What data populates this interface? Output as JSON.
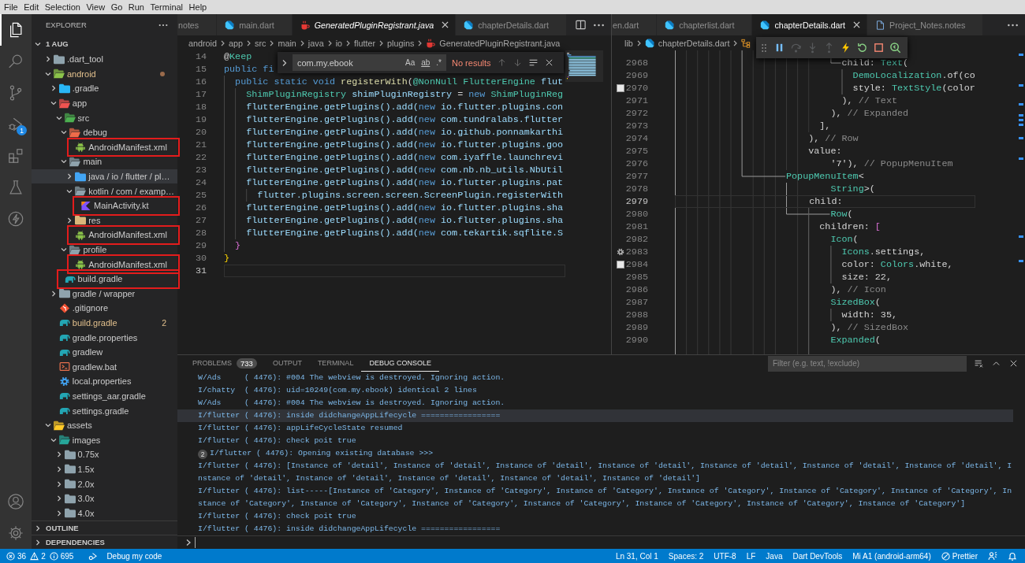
{
  "menu_bar": [
    "File",
    "Edit",
    "Selection",
    "View",
    "Go",
    "Run",
    "Terminal",
    "Help"
  ],
  "activity_bar": {
    "items": [
      {
        "kind": "files",
        "selected": true
      },
      {
        "kind": "search",
        "selected": false
      },
      {
        "kind": "source-control",
        "selected": false
      },
      {
        "kind": "run-debug",
        "selected": false,
        "badge": "1"
      },
      {
        "kind": "extensions",
        "selected": false
      },
      {
        "kind": "testing",
        "selected": false
      },
      {
        "kind": "lightning",
        "selected": false
      }
    ],
    "bottom": [
      {
        "kind": "account"
      },
      {
        "kind": "manage"
      }
    ]
  },
  "explorer": {
    "title": "EXPLORER",
    "root": {
      "label": "1 AUG",
      "expanded": true
    },
    "tree": [
      {
        "label": ".dart_tool",
        "kind": "folder",
        "expanded": false,
        "modified": false,
        "hovered": false,
        "annotated": false
      },
      {
        "label": "android",
        "kind": "android-folder",
        "expanded": true,
        "modified": true,
        "hovered": false,
        "annotated": false,
        "children": [
          {
            "label": ".gradle",
            "kind": "gradle-folder",
            "expanded": false,
            "modified": false,
            "hovered": false,
            "annotated": false
          },
          {
            "label": "app",
            "kind": "app-folder",
            "expanded": true,
            "modified": false,
            "hovered": false,
            "annotated": false,
            "children": [
              {
                "label": "src",
                "kind": "src-folder",
                "expanded": true,
                "modified": false,
                "hovered": false,
                "annotated": false,
                "children": [
                  {
                    "label": "debug",
                    "kind": "debug-folder",
                    "expanded": true,
                    "modified": false,
                    "hovered": false,
                    "annotated": false,
                    "children": [
                      {
                        "label": "AndroidManifest.xml",
                        "kind": "android-file",
                        "modified": false,
                        "hovered": false,
                        "annotated": true
                      }
                    ]
                  },
                  {
                    "label": "main",
                    "kind": "folder",
                    "expanded": true,
                    "modified": false,
                    "hovered": false,
                    "annotated": false,
                    "children": [
                      {
                        "label": "java / io / flutter / pl…",
                        "kind": "java-folder",
                        "expanded": false,
                        "modified": false,
                        "hovered": true,
                        "annotated": false
                      },
                      {
                        "label": "kotlin / com / examp…",
                        "kind": "folder",
                        "expanded": true,
                        "modified": false,
                        "hovered": false,
                        "annotated": false,
                        "children": [
                          {
                            "label": "MainActivity.kt",
                            "kind": "kotlin-file",
                            "modified": false,
                            "hovered": false,
                            "annotated": true
                          }
                        ]
                      },
                      {
                        "label": "res",
                        "kind": "res-folder",
                        "expanded": false,
                        "modified": false,
                        "hovered": false,
                        "annotated": false
                      },
                      {
                        "label": "AndroidManifest.xml",
                        "kind": "android-file",
                        "modified": false,
                        "hovered": false,
                        "annotated": true
                      }
                    ]
                  },
                  {
                    "label": "profile",
                    "kind": "folder",
                    "expanded": true,
                    "modified": false,
                    "hovered": false,
                    "annotated": false,
                    "children": [
                      {
                        "label": "AndroidManifest.xml",
                        "kind": "android-file",
                        "modified": false,
                        "hovered": false,
                        "annotated": true
                      }
                    ]
                  }
                ]
              },
              {
                "label": "build.gradle",
                "kind": "gradle-file",
                "modified": false,
                "hovered": false,
                "annotated": true
              }
            ]
          },
          {
            "label": "gradle / wrapper",
            "kind": "folder",
            "expanded": false,
            "modified": false,
            "hovered": false,
            "annotated": false
          },
          {
            "label": ".gitignore",
            "kind": "git-file",
            "modified": false,
            "hovered": false,
            "annotated": false
          },
          {
            "label": "build.gradle",
            "kind": "gradle-file",
            "modified": true,
            "badge": "2",
            "hovered": false,
            "annotated": false
          },
          {
            "label": "gradle.properties",
            "kind": "gradle-file",
            "modified": false,
            "hovered": false,
            "annotated": false
          },
          {
            "label": "gradlew",
            "kind": "gradle-file",
            "modified": false,
            "hovered": false,
            "annotated": false
          },
          {
            "label": "gradlew.bat",
            "kind": "script-file",
            "modified": false,
            "hovered": false,
            "annotated": false
          },
          {
            "label": "local.properties",
            "kind": "settings-file",
            "modified": false,
            "hovered": false,
            "annotated": false
          },
          {
            "label": "settings_aar.gradle",
            "kind": "gradle-file",
            "modified": false,
            "hovered": false,
            "annotated": false
          },
          {
            "label": "settings.gradle",
            "kind": "gradle-file",
            "modified": false,
            "hovered": false,
            "annotated": false
          }
        ]
      },
      {
        "label": "assets",
        "kind": "assets-folder",
        "expanded": true,
        "modified": false,
        "hovered": false,
        "annotated": false,
        "children": [
          {
            "label": "images",
            "kind": "images-folder",
            "expanded": true,
            "modified": false,
            "hovered": false,
            "annotated": false,
            "children": [
              {
                "label": "0.75x",
                "kind": "folder",
                "expanded": false,
                "modified": false,
                "hovered": false,
                "annotated": false
              },
              {
                "label": "1.5x",
                "kind": "folder",
                "expanded": false,
                "modified": false,
                "hovered": false,
                "annotated": false
              },
              {
                "label": "2.0x",
                "kind": "folder",
                "expanded": false,
                "modified": false,
                "hovered": false,
                "annotated": false
              },
              {
                "label": "3.0x",
                "kind": "folder",
                "expanded": false,
                "modified": false,
                "hovered": false,
                "annotated": false
              },
              {
                "label": "4.0x",
                "kind": "folder",
                "expanded": false,
                "modified": false,
                "hovered": false,
                "annotated": false
              }
            ]
          }
        ]
      }
    ],
    "sections": [
      {
        "label": "OUTLINE",
        "expanded": false
      },
      {
        "label": "DEPENDENCIES",
        "expanded": false
      }
    ]
  },
  "editor_groups": [
    {
      "tabs": [
        {
          "label": "notes",
          "kind": "partial",
          "selected": false,
          "preview": false
        },
        {
          "label": "main.dart",
          "kind": "dart",
          "selected": false,
          "preview": false
        },
        {
          "label": "GeneratedPluginRegistrant.java",
          "kind": "java",
          "selected": true,
          "preview": true
        },
        {
          "label": "chapterDetails.dart",
          "kind": "dart",
          "selected": false,
          "preview": false
        }
      ],
      "actions": [
        {
          "kind": "split"
        },
        {
          "kind": "more"
        }
      ],
      "breadcrumbs": [
        {
          "label": "android",
          "kind": "folder"
        },
        {
          "label": "app",
          "kind": "folder"
        },
        {
          "label": "src",
          "kind": "folder"
        },
        {
          "label": "main",
          "kind": "folder"
        },
        {
          "label": "java",
          "kind": "folder"
        },
        {
          "label": "io",
          "kind": "folder"
        },
        {
          "label": "flutter",
          "kind": "folder"
        },
        {
          "label": "plugins",
          "kind": "folder"
        },
        {
          "label": "GeneratedPluginRegistrant.java",
          "kind": "java"
        }
      ],
      "find_widget": {
        "expanded": false,
        "value": "com.my.ebook",
        "options": [
          {
            "label": "Aa",
            "on": false
          },
          {
            "label": "ab",
            "on": false
          },
          {
            "label": ".*",
            "on": false
          }
        ],
        "result": "No results",
        "buttons": [
          {
            "kind": "previous",
            "disabled": true
          },
          {
            "kind": "next",
            "disabled": true
          },
          {
            "kind": "in-selection",
            "disabled": false
          },
          {
            "kind": "close",
            "disabled": false
          }
        ]
      },
      "lines": [
        {
          "number": "14",
          "current": false,
          "tokens": [
            {
              "text": "@",
              "kind": "plain"
            },
            {
              "text": "Keep",
              "kind": "type"
            }
          ]
        },
        {
          "number": "15",
          "current": false,
          "tokens": [
            {
              "text": "public fi",
              "kind": "keyword"
            }
          ]
        },
        {
          "number": "16",
          "current": false,
          "tokens": [
            {
              "text": "  public static void ",
              "kind": "keyword"
            },
            {
              "text": "registerWith",
              "kind": "function"
            },
            {
              "text": "(",
              "kind": "plain"
            },
            {
              "text": "@NonNull FlutterEngine ",
              "kind": "type"
            },
            {
              "text": "flut",
              "kind": "variable"
            }
          ]
        },
        {
          "number": "17",
          "current": false,
          "tokens": [
            {
              "text": "    ShimPluginRegistry ",
              "kind": "type"
            },
            {
              "text": "shimPluginRegistry ",
              "kind": "variable"
            },
            {
              "text": "= ",
              "kind": "plain"
            },
            {
              "text": "new",
              "kind": "keyword"
            },
            {
              "text": " ShimPluginReg",
              "kind": "type"
            }
          ]
        },
        {
          "number": "18",
          "current": false,
          "tokens": [
            {
              "text": "    flutterEngine.getPlugins().add(",
              "kind": "variable"
            },
            {
              "text": "new",
              "kind": "keyword"
            },
            {
              "text": " io.flutter.plugins.con",
              "kind": "variable"
            }
          ]
        },
        {
          "number": "19",
          "current": false,
          "tokens": [
            {
              "text": "    flutterEngine.getPlugins().add(",
              "kind": "variable"
            },
            {
              "text": "new",
              "kind": "keyword"
            },
            {
              "text": " com.tundralabs.flutter",
              "kind": "variable"
            }
          ]
        },
        {
          "number": "20",
          "current": false,
          "tokens": [
            {
              "text": "    flutterEngine.getPlugins().add(",
              "kind": "variable"
            },
            {
              "text": "new",
              "kind": "keyword"
            },
            {
              "text": " io.github.ponnamkarthi",
              "kind": "variable"
            }
          ]
        },
        {
          "number": "21",
          "current": false,
          "tokens": [
            {
              "text": "    flutterEngine.getPlugins().add(",
              "kind": "variable"
            },
            {
              "text": "new",
              "kind": "keyword"
            },
            {
              "text": " io.flutter.plugins.goo",
              "kind": "variable"
            }
          ]
        },
        {
          "number": "22",
          "current": false,
          "tokens": [
            {
              "text": "    flutterEngine.getPlugins().add(",
              "kind": "variable"
            },
            {
              "text": "new",
              "kind": "keyword"
            },
            {
              "text": " com.iyaffle.launchrevi",
              "kind": "variable"
            }
          ]
        },
        {
          "number": "23",
          "current": false,
          "tokens": [
            {
              "text": "    flutterEngine.getPlugins().add(",
              "kind": "variable"
            },
            {
              "text": "new",
              "kind": "keyword"
            },
            {
              "text": " com.nb.nb_utils.NbUtil",
              "kind": "variable"
            }
          ]
        },
        {
          "number": "24",
          "current": false,
          "tokens": [
            {
              "text": "    flutterEngine.getPlugins().add(",
              "kind": "variable"
            },
            {
              "text": "new",
              "kind": "keyword"
            },
            {
              "text": " io.flutter.plugins.pat",
              "kind": "variable"
            }
          ]
        },
        {
          "number": "25",
          "current": false,
          "tokens": [
            {
              "text": "      flutter.plugins.screen.screen.ScreenPlugin.registerWith",
              "kind": "variable"
            }
          ]
        },
        {
          "number": "26",
          "current": false,
          "tokens": [
            {
              "text": "    flutterEngine.getPlugins().add(",
              "kind": "variable"
            },
            {
              "text": "new",
              "kind": "keyword"
            },
            {
              "text": " io.flutter.plugins.sha",
              "kind": "variable"
            }
          ]
        },
        {
          "number": "27",
          "current": false,
          "tokens": [
            {
              "text": "    flutterEngine.getPlugins().add(",
              "kind": "variable"
            },
            {
              "text": "new",
              "kind": "keyword"
            },
            {
              "text": " io.flutter.plugins.sha",
              "kind": "variable"
            }
          ]
        },
        {
          "number": "28",
          "current": false,
          "tokens": [
            {
              "text": "    flutterEngine.getPlugins().add(",
              "kind": "variable"
            },
            {
              "text": "new",
              "kind": "keyword"
            },
            {
              "text": " com.tekartik.sqflite.S",
              "kind": "variable"
            }
          ]
        },
        {
          "number": "29",
          "current": false,
          "tokens": [
            {
              "text": "  }",
              "kind": "bracket-inner"
            }
          ]
        },
        {
          "number": "30",
          "current": false,
          "tokens": [
            {
              "text": "}",
              "kind": "bracket-outer"
            }
          ]
        },
        {
          "number": "31",
          "current": true
        }
      ]
    },
    {
      "tabs": [
        {
          "label": "en.dart",
          "kind": "partial",
          "selected": false,
          "preview": false
        },
        {
          "label": "chapterlist.dart",
          "kind": "dart",
          "selected": false,
          "preview": false
        },
        {
          "label": "chapterDetails.dart",
          "kind": "dart",
          "selected": true,
          "preview": false
        },
        {
          "label": "Project_Notes.notes",
          "kind": "notes",
          "selected": false,
          "preview": false
        }
      ],
      "actions": [
        {
          "kind": "more"
        }
      ],
      "breadcrumbs": [
        {
          "label": "lib",
          "kind": "folder"
        },
        {
          "label": "chapterDetails.dart",
          "kind": "dart"
        },
        {
          "kind": "symbol"
        }
      ],
      "debug_toolbar": [
        {
          "kind": "pause",
          "disabled": false
        },
        {
          "kind": "step-over",
          "disabled": true
        },
        {
          "kind": "step-into",
          "disabled": true
        },
        {
          "kind": "step-out",
          "disabled": true
        },
        {
          "kind": "hot-reload",
          "disabled": false
        },
        {
          "kind": "restart",
          "disabled": false
        },
        {
          "kind": "stop",
          "disabled": false
        },
        {
          "kind": "devtools",
          "disabled": false
        }
      ],
      "lines": [
        {
          "number": "2968",
          "kind": "code",
          "current": false,
          "tokens": [
            {
              "text": "                              child: ",
              "kind": "plain"
            },
            {
              "text": "Text",
              "kind": "type"
            },
            {
              "text": "(",
              "kind": "plain"
            }
          ]
        },
        {
          "number": "2969",
          "kind": "code",
          "current": false,
          "tokens": [
            {
              "text": "                                DemoLocalization",
              "kind": "type"
            },
            {
              "text": ".of(co",
              "kind": "plain"
            }
          ]
        },
        {
          "number": "2970",
          "kind": "color-preview",
          "current": false,
          "tokens": [
            {
              "text": "                                style: ",
              "kind": "plain"
            },
            {
              "text": "TextStyle",
              "kind": "type"
            },
            {
              "text": "(color",
              "kind": "plain"
            }
          ]
        },
        {
          "number": "2971",
          "kind": "code",
          "current": false,
          "tokens": [
            {
              "text": "                              ), ",
              "kind": "plain"
            },
            {
              "text": "// Text",
              "kind": "comment"
            }
          ]
        },
        {
          "number": "2972",
          "kind": "code",
          "current": false,
          "tokens": [
            {
              "text": "                            ), ",
              "kind": "plain"
            },
            {
              "text": "// Expanded",
              "kind": "comment"
            }
          ]
        },
        {
          "number": "2973",
          "kind": "code",
          "current": false,
          "tokens": [
            {
              "text": "                          ],",
              "kind": "plain"
            }
          ]
        },
        {
          "number": "2974",
          "kind": "code",
          "current": false,
          "tokens": [
            {
              "text": "                        ), ",
              "kind": "plain"
            },
            {
              "text": "// Row",
              "kind": "comment"
            }
          ]
        },
        {
          "number": "2975",
          "kind": "code",
          "current": false,
          "tokens": [
            {
              "text": "                        value:",
              "kind": "plain"
            }
          ]
        },
        {
          "number": "2976",
          "kind": "code",
          "current": false,
          "tokens": [
            {
              "text": "                            '7'), ",
              "kind": "plain"
            },
            {
              "text": "// PopupMenuItem",
              "kind": "comment"
            }
          ]
        },
        {
          "number": "2977",
          "kind": "code",
          "current": false,
          "tokens": [
            {
              "text": "                    PopupMenuItem",
              "kind": "type"
            },
            {
              "text": "<",
              "kind": "plain"
            }
          ]
        },
        {
          "number": "2978",
          "kind": "code",
          "current": false,
          "tokens": [
            {
              "text": "                            String",
              "kind": "type"
            },
            {
              "text": ">(",
              "kind": "plain"
            }
          ]
        },
        {
          "number": "2979",
          "kind": "code",
          "current": true,
          "tokens": [
            {
              "text": "                        child:",
              "kind": "plain"
            }
          ]
        },
        {
          "number": "2980",
          "kind": "code",
          "current": false,
          "tokens": [
            {
              "text": "                            Row",
              "kind": "type"
            },
            {
              "text": "(",
              "kind": "plain"
            }
          ]
        },
        {
          "number": "2981",
          "kind": "code",
          "current": false,
          "tokens": [
            {
              "text": "                          children: ",
              "kind": "plain"
            },
            {
              "text": "[",
              "kind": "bracket-inner"
            }
          ]
        },
        {
          "number": "2982",
          "kind": "code",
          "current": false,
          "tokens": [
            {
              "text": "                            Icon",
              "kind": "type"
            },
            {
              "text": "(",
              "kind": "plain"
            }
          ]
        },
        {
          "number": "2983",
          "kind": "icon-preview",
          "current": false,
          "tokens": [
            {
              "text": "                              Icons",
              "kind": "type"
            },
            {
              "text": ".settings,",
              "kind": "plain"
            }
          ]
        },
        {
          "number": "2984",
          "kind": "color-preview",
          "current": false,
          "tokens": [
            {
              "text": "                              color: ",
              "kind": "plain"
            },
            {
              "text": "Colors",
              "kind": "type"
            },
            {
              "text": ".white,",
              "kind": "plain"
            }
          ]
        },
        {
          "number": "2985",
          "kind": "code",
          "current": false,
          "tokens": [
            {
              "text": "                              size: 22,",
              "kind": "plain"
            }
          ]
        },
        {
          "number": "2986",
          "kind": "code",
          "current": false,
          "tokens": [
            {
              "text": "                            ), ",
              "kind": "plain"
            },
            {
              "text": "// Icon",
              "kind": "comment"
            }
          ]
        },
        {
          "number": "2987",
          "kind": "code",
          "current": false,
          "tokens": [
            {
              "text": "                            SizedBox",
              "kind": "type"
            },
            {
              "text": "(",
              "kind": "plain"
            }
          ]
        },
        {
          "number": "2988",
          "kind": "code",
          "current": false,
          "tokens": [
            {
              "text": "                              width: 35,",
              "kind": "plain"
            }
          ]
        },
        {
          "number": "2989",
          "kind": "code",
          "current": false,
          "tokens": [
            {
              "text": "                            ), ",
              "kind": "plain"
            },
            {
              "text": "// SizedBox",
              "kind": "comment"
            }
          ]
        },
        {
          "number": "2990",
          "kind": "code",
          "current": false,
          "tokens": [
            {
              "text": "                            Expanded",
              "kind": "type"
            },
            {
              "text": "(",
              "kind": "plain"
            }
          ]
        }
      ]
    }
  ],
  "panel": {
    "tabs": [
      {
        "label": "PROBLEMS",
        "badge": "733",
        "selected": false
      },
      {
        "label": "OUTPUT",
        "selected": false
      },
      {
        "label": "TERMINAL",
        "selected": false
      },
      {
        "label": "DEBUG CONSOLE",
        "selected": true
      }
    ],
    "filter": {
      "placeholder": "Filter (e.g. text, !exclude)"
    },
    "actions": [
      {
        "kind": "clear"
      },
      {
        "kind": "maximize"
      },
      {
        "kind": "close"
      }
    ],
    "console": [
      {
        "text": "W/Ads     ( 4476): #004 The webview is destroyed. Ignoring action.",
        "hovered": false
      },
      {
        "text": "I/chatty  ( 4476): uid=10249(com.my.ebook) identical 2 lines",
        "hovered": false
      },
      {
        "text": "W/Ads     ( 4476): #004 The webview is destroyed. Ignoring action.",
        "hovered": false
      },
      {
        "text": "I/flutter ( 4476): inside didchangeAppLifecycle =================",
        "hovered": true
      },
      {
        "text": "I/flutter ( 4476): appLifeCycleState resumed",
        "hovered": false
      },
      {
        "text": "I/flutter ( 4476): check poit true",
        "hovered": false
      },
      {
        "text": "I/flutter ( 4476): Opening existing database >>>",
        "count": "2",
        "hovered": false
      },
      {
        "text": "I/flutter ( 4476): [Instance of 'detail', Instance of 'detail', Instance of 'detail', Instance of 'detail', Instance of 'detail', Instance of 'detail', Instance of 'detail', Instance of 'detail', Instance of 'detail', Instance of 'detail', Instance of 'detail', Instance of 'detail']",
        "hovered": false
      },
      {
        "text": "I/flutter ( 4476): list-----[Instance of 'Category', Instance of 'Category', Instance of 'Category', Instance of 'Category', Instance of 'Category', Instance of 'Category', Instance of 'Category', Instance of 'Category', Instance of 'Category', Instance of 'Category', Instance of 'Category', Instance of 'Category', Instance of 'Category']",
        "hovered": false
      },
      {
        "text": "I/flutter ( 4476): check poit true",
        "hovered": false
      },
      {
        "text": "I/flutter ( 4476): inside didchangeAppLifecycle =================",
        "hovered": false
      }
    ]
  },
  "status_bar": {
    "problems": [
      {
        "kind": "error",
        "count": "36"
      },
      {
        "kind": "warning",
        "count": "2"
      },
      {
        "kind": "info",
        "count": "695"
      }
    ],
    "launch": {
      "label": "Debug my code"
    },
    "items": [
      {
        "kind": "text",
        "label": "Ln 31, Col 1"
      },
      {
        "kind": "text",
        "label": "Spaces: 2"
      },
      {
        "kind": "text",
        "label": "UTF-8"
      },
      {
        "kind": "text",
        "label": "LF"
      },
      {
        "kind": "text",
        "label": "Java"
      },
      {
        "kind": "text",
        "label": "Dart DevTools"
      },
      {
        "kind": "text",
        "label": "Mi A1 (android-arm64)"
      },
      {
        "kind": "prohibited",
        "label": "Prettier"
      },
      {
        "kind": "feedback"
      },
      {
        "kind": "notifications"
      }
    ]
  }
}
